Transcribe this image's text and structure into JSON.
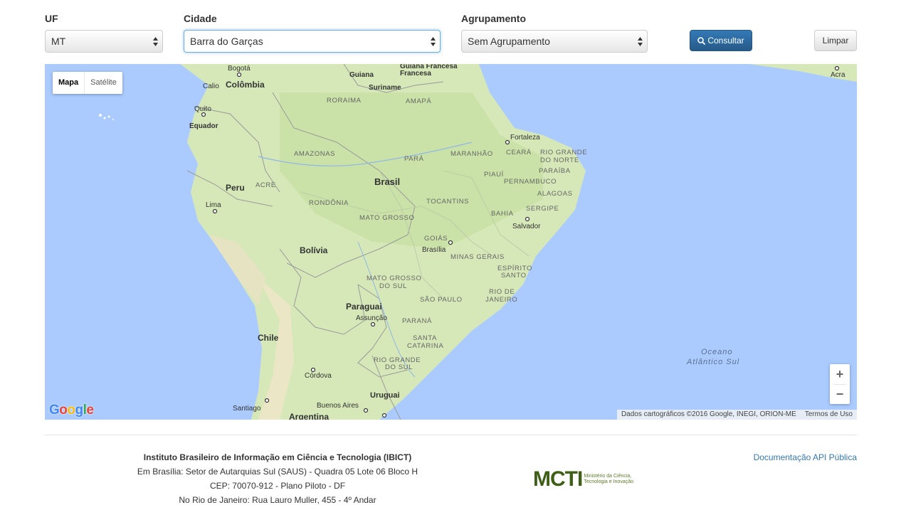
{
  "filters": {
    "uf": {
      "label": "UF",
      "value": "MT"
    },
    "cidade": {
      "label": "Cidade",
      "value": "Barra do Garças"
    },
    "agrupamento": {
      "label": "Agrupamento",
      "value": "Sem Agrupamento"
    }
  },
  "buttons": {
    "consultar": "Consultar",
    "limpar": "Limpar"
  },
  "map": {
    "type_controls": {
      "map": "Mapa",
      "satellite": "Satélite"
    },
    "zoom": {
      "in": "+",
      "out": "−"
    },
    "attribution": "Dados cartográficos ©2016 Google, INEGI, ORION-ME",
    "terms": "Termos de Uso",
    "logo": "Google",
    "labels": {
      "bogota": "Bogotá",
      "colombia": "Colômbia",
      "calio": "Calio",
      "quito": "Quito",
      "equador": "Equador",
      "guiana": "Guiana",
      "guiana_francesa": "Guiana Francesa",
      "francesa": "Francesa",
      "suriname": "Suriname",
      "roraima": "RORAIMA",
      "amapa": "AMAPÁ",
      "amazonas": "AMAZONAS",
      "para": "PARÁ",
      "maranhao": "MARANHÃO",
      "fortaleza": "Fortaleza",
      "ceara": "CEARÁ",
      "rio_grande_do_norte_1": "RIO GRANDE",
      "rio_grande_do_norte_2": "DO NORTE",
      "paraiba": "PARAÍBA",
      "piaui": "PIAUÍ",
      "pernambuco": "PERNAMBUCO",
      "alagoas": "ALAGOAS",
      "sergipe": "SERGIPE",
      "bahia": "BAHIA",
      "salvador": "Salvador",
      "brasil": "Brasil",
      "acre": "ACRE",
      "peru": "Peru",
      "rondonia": "RONDÔNIA",
      "tocantins": "TOCANTINS",
      "lima": "Lima",
      "mato_grosso": "MATO GROSSO",
      "goias": "GOIÁS",
      "brasilia": "Brasília",
      "bolivia": "Bolívia",
      "minas_gerais": "MINAS GERAIS",
      "mato_grosso_do_sul_1": "MATO GROSSO",
      "mato_grosso_do_sul_2": "DO SUL",
      "espirito_santo_1": "ESPÍRITO",
      "espirito_santo_2": "SANTO",
      "rio_de_janeiro_1": "RIO DE",
      "rio_de_janeiro_2": "JANEIRO",
      "sao_paulo": "SÃO PAULO",
      "paraguai": "Paraguai",
      "assuncao": "Assunção",
      "parana": "PARANÁ",
      "chile": "Chile",
      "santa_catarina_1": "SANTA",
      "santa_catarina_2": "CATARINA",
      "rio_grande_do_sul_1": "RIO GRANDE",
      "rio_grande_do_sul_2": "DO SUL",
      "cordova": "Córdova",
      "uruguai": "Uruguai",
      "santiago": "Santiago",
      "buenos_aires": "Buenos Aires",
      "argentina": "Argentina",
      "oceano": "Oceano",
      "atlantico_sul": "Atlântico Sul",
      "acra": "Acra"
    }
  },
  "footer": {
    "org_name": "Instituto Brasileiro de Informação em Ciência e Tecnologia (IBICT)",
    "address_1": "Em Brasília: Setor de Autarquias Sul (SAUS) - Quadra 05 Lote 06 Bloco H",
    "address_2": "CEP: 70070-912 - Plano Piloto - DF",
    "address_3": "No Rio de Janeiro: Rua Lauro Muller, 455 - 4º Andar",
    "api_link": "Documentação API Pública",
    "mcti_logo": "MCTI",
    "mcti_sub_1": "Ministério da Ciência,",
    "mcti_sub_2": "Tecnologia e Inovação"
  },
  "colors": {
    "primary": "#2e6da4",
    "ocean": "#abcbff",
    "land": "#cde4b3",
    "link": "#337ab7",
    "mcti_green": "#3f5f17"
  }
}
